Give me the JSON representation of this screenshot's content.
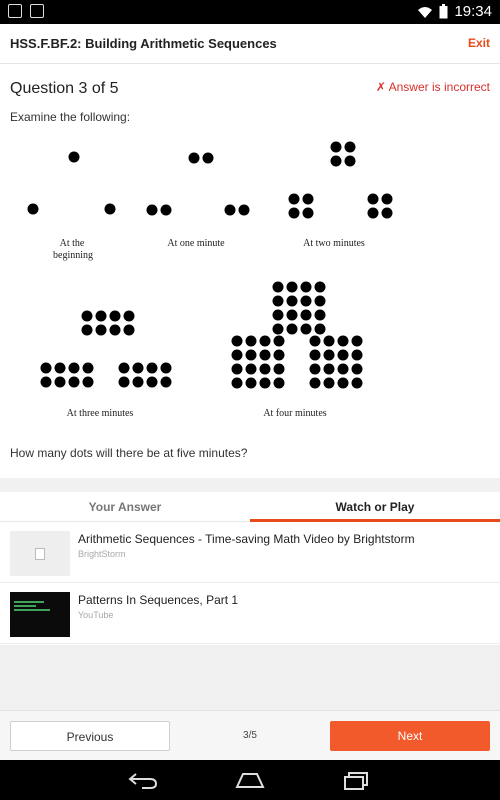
{
  "status_bar": {
    "time": "19:34"
  },
  "app_bar": {
    "title": "HSS.F.BF.2: Building Arithmetic Sequences",
    "exit_label": "Exit"
  },
  "question_header": {
    "counter": "Question 3 of 5",
    "verdict": "✗ Answer is incorrect"
  },
  "prompt": "Examine the following:",
  "figure": {
    "captions": [
      "At the",
      "beginning",
      "At one minute",
      "At two minutes",
      "At three minutes",
      "At four minutes"
    ]
  },
  "question_text": "How many dots will there be at five minutes?",
  "tabs": [
    {
      "label": "Your Answer",
      "selected": false
    },
    {
      "label": "Watch or Play",
      "selected": true
    }
  ],
  "resources": [
    {
      "title": "Arithmetic Sequences - Time-saving Math Video by Brightstorm",
      "source": "BrightStorm"
    },
    {
      "title": "Patterns In Sequences, Part 1",
      "source": "YouTube"
    }
  ],
  "footer": {
    "previous_label": "Previous",
    "page_indicator": "3/5",
    "next_label": "Next"
  },
  "colors": {
    "accent": "#f2592b",
    "error": "#d9302b"
  }
}
